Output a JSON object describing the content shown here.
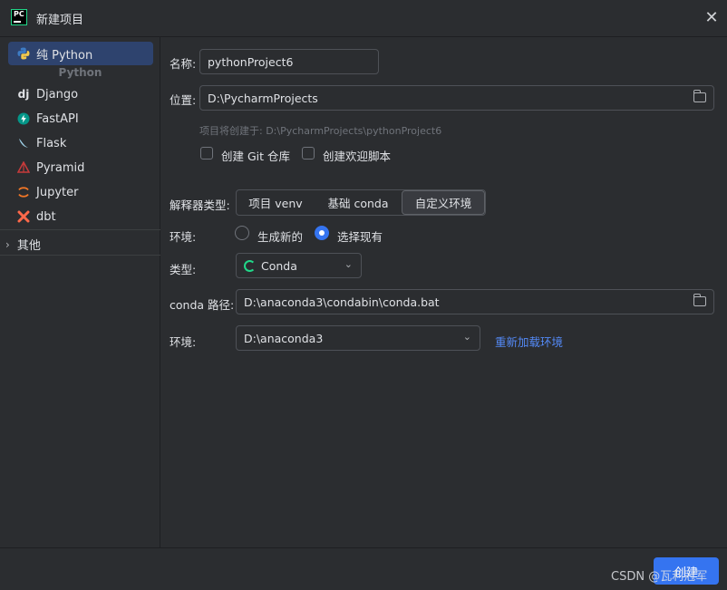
{
  "window": {
    "title": "新建项目",
    "app_icon_text": "PC"
  },
  "sidebar": {
    "selected": {
      "label": "纯 Python"
    },
    "group_header": "Python",
    "items": [
      {
        "label": "Django",
        "icon": "django-icon"
      },
      {
        "label": "FastAPI",
        "icon": "fastapi-icon"
      },
      {
        "label": "Flask",
        "icon": "flask-icon"
      },
      {
        "label": "Pyramid",
        "icon": "pyramid-icon"
      },
      {
        "label": "Jupyter",
        "icon": "jupyter-icon"
      },
      {
        "label": "dbt",
        "icon": "dbt-icon"
      }
    ],
    "other": "其他"
  },
  "form": {
    "name_label": "名称:",
    "name_value": "pythonProject6",
    "location_label": "位置:",
    "location_value": "D:\\PycharmProjects",
    "location_hint": "项目将创建于: D:\\PycharmProjects\\pythonProject6",
    "git_checkbox": "创建 Git 仓库",
    "welcome_checkbox": "创建欢迎脚本",
    "interpreter_label": "解释器类型:",
    "interpreter_tabs": [
      "项目 venv",
      "基础 conda",
      "自定义环境"
    ],
    "interpreter_active": "自定义环境",
    "env_label": "环境:",
    "env_option_new": "生成新的",
    "env_option_existing": "选择现有",
    "type_label": "类型:",
    "type_value": "Conda",
    "conda_path_label": "conda 路径:",
    "conda_path_value": "D:\\anaconda3\\condabin\\conda.bat",
    "env2_label": "环境:",
    "env2_value": "D:\\anaconda3",
    "reload_link": "重新加载环境"
  },
  "footer": {
    "create_button": "创建",
    "watermark": "CSDN @瓦利冠军"
  },
  "colors": {
    "accent": "#3574f0",
    "selection": "#2e436e",
    "link": "#548af7"
  }
}
